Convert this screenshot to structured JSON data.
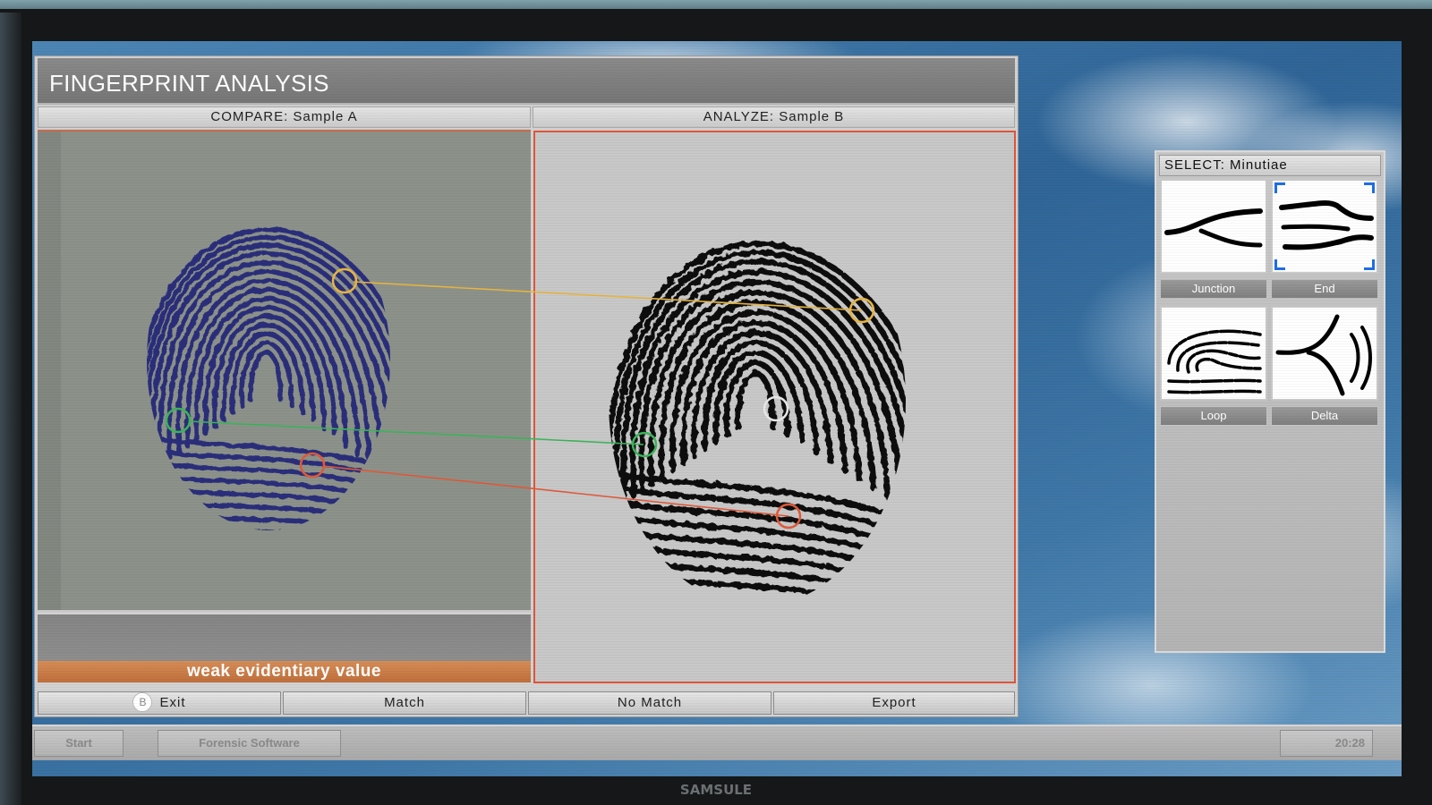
{
  "window": {
    "title": "FINGERPRINT ANALYSIS"
  },
  "panels": {
    "compare_label": "COMPARE: Sample A",
    "analyze_label": "ANALYZE: Sample B",
    "evidence_status": "weak evidentiary value"
  },
  "buttons": {
    "exit_key": "B",
    "exit": "Exit",
    "match": "Match",
    "no_match": "No Match",
    "export": "Export"
  },
  "minutiae": {
    "header": "SELECT: Minutiae",
    "items": [
      {
        "label": "Junction",
        "icon": "junction-icon",
        "selected": false
      },
      {
        "label": "End",
        "icon": "end-icon",
        "selected": true
      },
      {
        "label": "Loop",
        "icon": "loop-icon",
        "selected": false
      },
      {
        "label": "Delta",
        "icon": "delta-icon",
        "selected": false
      }
    ],
    "selection_color": "#1e6ee6"
  },
  "match_colors": {
    "yellow": "#e8b540",
    "green": "#3bb55a",
    "red": "#e05a3a"
  },
  "taskbar": {
    "start": "Start",
    "app": "Forensic Software",
    "clock": "20:28"
  },
  "monitor": {
    "brand": "SAMSULE"
  }
}
